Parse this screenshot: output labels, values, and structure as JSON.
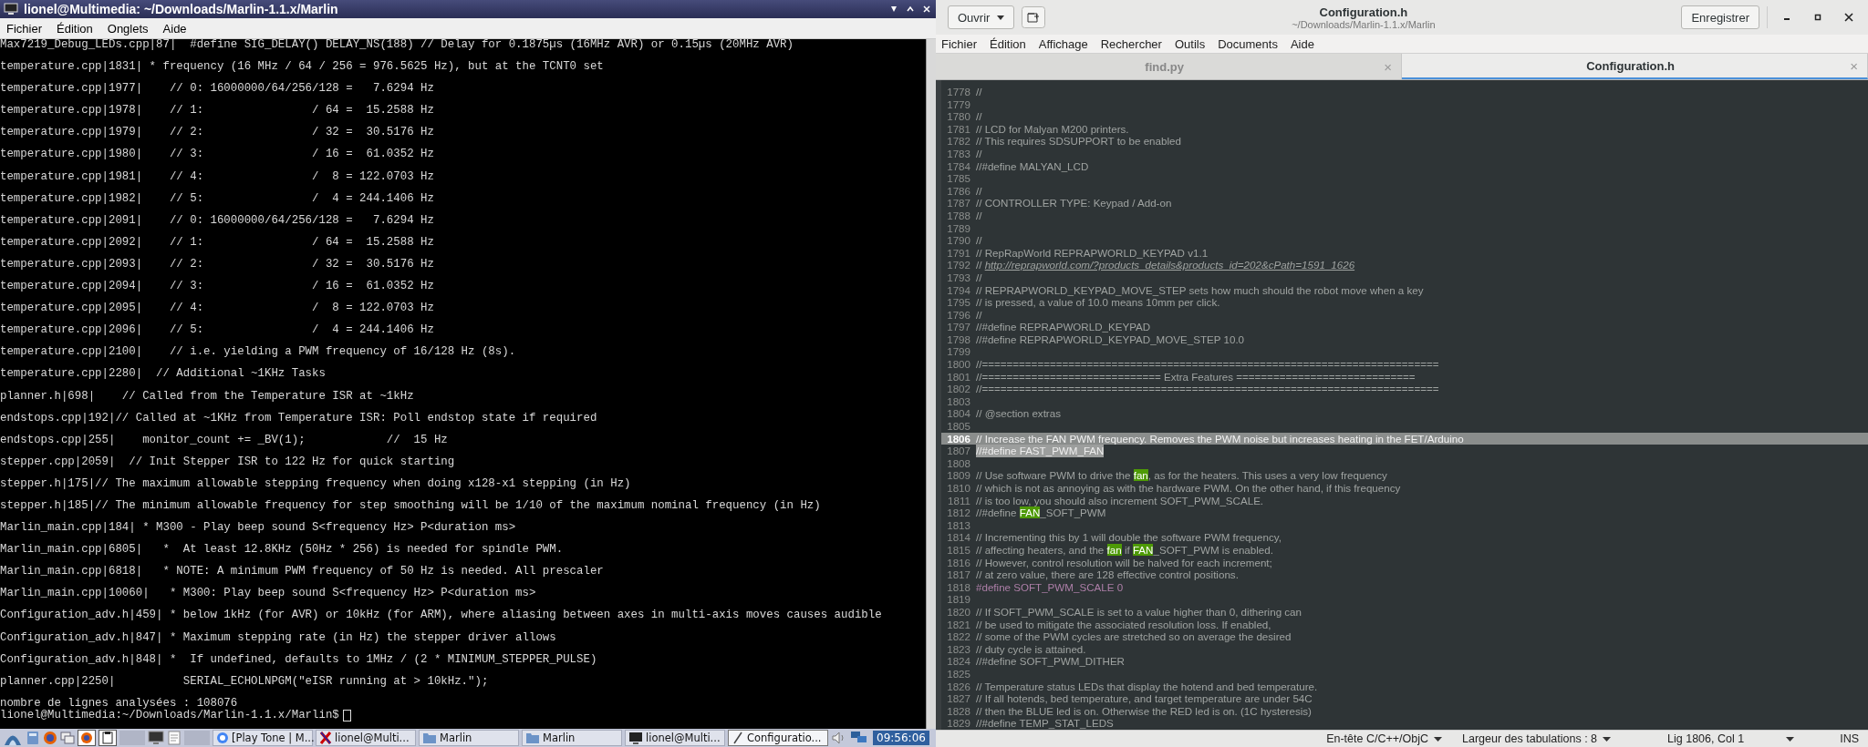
{
  "terminal": {
    "title": "lionel@Multimedia: ~/Downloads/Marlin-1.1.x/Marlin",
    "menu": [
      "Fichier",
      "Édition",
      "Onglets",
      "Aide"
    ],
    "lines": [
      "Max7219_Debug_LEDs.cpp|87|  #define SIG_DELAY() DELAY_NS(188) // Delay for 0.1875µs (16MHz AVR) or 0.15µs (20MHz AVR)",
      "temperature.cpp|1831| * frequency (16 MHz / 64 / 256 = 976.5625 Hz), but at the TCNT0 set",
      "temperature.cpp|1977|    // 0: 16000000/64/256/128 =   7.6294 Hz",
      "temperature.cpp|1978|    // 1:                / 64 =  15.2588 Hz",
      "temperature.cpp|1979|    // 2:                / 32 =  30.5176 Hz",
      "temperature.cpp|1980|    // 3:                / 16 =  61.0352 Hz",
      "temperature.cpp|1981|    // 4:                /  8 = 122.0703 Hz",
      "temperature.cpp|1982|    // 5:                /  4 = 244.1406 Hz",
      "temperature.cpp|2091|    // 0: 16000000/64/256/128 =   7.6294 Hz",
      "temperature.cpp|2092|    // 1:                / 64 =  15.2588 Hz",
      "temperature.cpp|2093|    // 2:                / 32 =  30.5176 Hz",
      "temperature.cpp|2094|    // 3:                / 16 =  61.0352 Hz",
      "temperature.cpp|2095|    // 4:                /  8 = 122.0703 Hz",
      "temperature.cpp|2096|    // 5:                /  4 = 244.1406 Hz",
      "temperature.cpp|2100|    // i.e. yielding a PWM frequency of 16/128 Hz (8s).",
      "temperature.cpp|2280|  // Additional ~1KHz Tasks",
      "planner.h|698|    // Called from the Temperature ISR at ~1kHz",
      "endstops.cpp|192|// Called at ~1KHz from Temperature ISR: Poll endstop state if required",
      "endstops.cpp|255|    monitor_count += _BV(1);            //  15 Hz",
      "stepper.cpp|2059|  // Init Stepper ISR to 122 Hz for quick starting",
      "stepper.h|175|// The maximum allowable stepping frequency when doing x128-x1 stepping (in Hz)",
      "stepper.h|185|// The minimum allowable frequency for step smoothing will be 1/10 of the maximum nominal frequency (in Hz)",
      "Marlin_main.cpp|184| * M300 - Play beep sound S<frequency Hz> P<duration ms>",
      "Marlin_main.cpp|6805|   *  At least 12.8KHz (50Hz * 256) is needed for spindle PWM.",
      "Marlin_main.cpp|6818|   * NOTE: A minimum PWM frequency of 50 Hz is needed. All prescaler",
      "Marlin_main.cpp|10060|   * M300: Play beep sound S<frequency Hz> P<duration ms>",
      "Configuration_adv.h|459| * below 1kHz (for AVR) or 10kHz (for ARM), where aliasing between axes in multi-axis moves causes audible",
      "Configuration_adv.h|847| * Maximum stepping rate (in Hz) the stepper driver allows",
      "Configuration_adv.h|848| *  If undefined, defaults to 1MHz / (2 * MINIMUM_STEPPER_PULSE)",
      "planner.cpp|2250|          SERIAL_ECHOLNPGM(\"eISR running at > 10kHz.\");"
    ],
    "summary": "nombre de lignes analysées : 108076",
    "prompt": "lionel@Multimedia:~/Downloads/Marlin-1.1.x/Marlin$"
  },
  "editor": {
    "open_button": "Ouvrir",
    "title": "Configuration.h",
    "path": "~/Downloads/Marlin-1.1.x/Marlin",
    "save_button": "Enregistrer",
    "menu": [
      "Fichier",
      "Édition",
      "Affichage",
      "Rechercher",
      "Outils",
      "Documents",
      "Aide"
    ],
    "tabs": [
      {
        "label": "find.py",
        "close": "×",
        "selected": false
      },
      {
        "label": "Configuration.h",
        "close": "×",
        "selected": true
      }
    ],
    "lines": [
      {
        "number": "1778",
        "current": false,
        "selected": false,
        "kind": "comment",
        "text": "//"
      },
      {
        "number": "1779",
        "current": false,
        "selected": false
      },
      {
        "number": "1780",
        "current": false,
        "selected": false,
        "kind": "comment",
        "text": "//"
      },
      {
        "number": "1781",
        "current": false,
        "selected": false,
        "kind": "comment",
        "text": "// LCD for Malyan M200 printers."
      },
      {
        "number": "1782",
        "current": false,
        "selected": false,
        "kind": "comment",
        "text": "// This requires SDSUPPORT to be enabled"
      },
      {
        "number": "1783",
        "current": false,
        "selected": false,
        "kind": "comment",
        "text": "//"
      },
      {
        "number": "1784",
        "current": false,
        "selected": false,
        "kind": "comment",
        "text": "//#define MALYAN_LCD"
      },
      {
        "number": "1785",
        "current": false,
        "selected": false
      },
      {
        "number": "1786",
        "current": false,
        "selected": false,
        "kind": "comment",
        "text": "//"
      },
      {
        "number": "1787",
        "current": false,
        "selected": false,
        "kind": "comment",
        "text": "// CONTROLLER TYPE: Keypad / Add-on"
      },
      {
        "number": "1788",
        "current": false,
        "selected": false,
        "kind": "comment",
        "text": "//"
      },
      {
        "number": "1789",
        "current": false,
        "selected": false
      },
      {
        "number": "1790",
        "current": false,
        "selected": false,
        "kind": "comment",
        "text": "//"
      },
      {
        "number": "1791",
        "current": false,
        "selected": false,
        "kind": "comment",
        "text": "// RepRapWorld REPRAPWORLD_KEYPAD v1.1"
      },
      {
        "number": "1792",
        "current": false,
        "selected": false,
        "parts": [
          {
            "kind": "comment",
            "text": "// "
          },
          {
            "kind": "link",
            "text": "http://reprapworld.com/?products_details&products_id=202&cPath=1591_1626"
          }
        ]
      },
      {
        "number": "1793",
        "current": false,
        "selected": false,
        "kind": "comment",
        "text": "//"
      },
      {
        "number": "1794",
        "current": false,
        "selected": false,
        "kind": "comment",
        "text": "// REPRAPWORLD_KEYPAD_MOVE_STEP sets how much should the robot move when a key"
      },
      {
        "number": "1795",
        "current": false,
        "selected": false,
        "kind": "comment",
        "text": "// is pressed, a value of 10.0 means 10mm per click."
      },
      {
        "number": "1796",
        "current": false,
        "selected": false,
        "kind": "comment",
        "text": "//"
      },
      {
        "number": "1797",
        "current": false,
        "selected": false,
        "kind": "comment",
        "text": "//#define REPRAPWORLD_KEYPAD"
      },
      {
        "number": "1798",
        "current": false,
        "selected": false,
        "kind": "comment",
        "text": "//#define REPRAPWORLD_KEYPAD_MOVE_STEP 10.0"
      },
      {
        "number": "1799",
        "current": false,
        "selected": false
      },
      {
        "number": "1800",
        "current": false,
        "selected": false,
        "kind": "comment",
        "text": "//=========================================================================="
      },
      {
        "number": "1801",
        "current": false,
        "selected": false,
        "kind": "comment",
        "text": "//============================= Extra Features ============================="
      },
      {
        "number": "1802",
        "current": false,
        "selected": false,
        "kind": "comment",
        "text": "//=========================================================================="
      },
      {
        "number": "1803",
        "current": false,
        "selected": false
      },
      {
        "number": "1804",
        "current": false,
        "selected": false,
        "kind": "comment",
        "text": "// @section extras"
      },
      {
        "number": "1805",
        "current": false,
        "selected": false
      },
      {
        "number": "1806",
        "current": true,
        "selected": false,
        "kind": "comment",
        "text": "// Increase the FAN PWM frequency. Removes the PWM noise but increases heating in the FET/Arduino"
      },
      {
        "number": "1807",
        "current": false,
        "selected": true,
        "kind": "comment",
        "text": "//#define FAST_PWM_FAN"
      },
      {
        "number": "1808",
        "current": false,
        "selected": false
      },
      {
        "number": "1809",
        "current": false,
        "selected": false,
        "parts": [
          {
            "kind": "comment",
            "text": "// Use software PWM to drive the "
          },
          {
            "kind": "match",
            "text": "fan"
          },
          {
            "kind": "comment",
            "text": ", as for the heaters. This uses a very low frequency"
          }
        ]
      },
      {
        "number": "1810",
        "current": false,
        "selected": false,
        "kind": "comment",
        "text": "// which is not as annoying as with the hardware PWM. On the other hand, if this frequency"
      },
      {
        "number": "1811",
        "current": false,
        "selected": false,
        "kind": "comment",
        "text": "// is too low, you should also increment SOFT_PWM_SCALE."
      },
      {
        "number": "1812",
        "current": false,
        "selected": false,
        "parts": [
          {
            "kind": "comment",
            "text": "//#define "
          },
          {
            "kind": "match",
            "text": "FAN"
          },
          {
            "kind": "comment",
            "text": "_SOFT_PWM"
          }
        ]
      },
      {
        "number": "1813",
        "current": false,
        "selected": false
      },
      {
        "number": "1814",
        "current": false,
        "selected": false,
        "kind": "comment",
        "text": "// Incrementing this by 1 will double the software PWM frequency,"
      },
      {
        "number": "1815",
        "current": false,
        "selected": false,
        "parts": [
          {
            "kind": "comment",
            "text": "// affecting heaters, and the "
          },
          {
            "kind": "match",
            "text": "fan"
          },
          {
            "kind": "comment",
            "text": " if "
          },
          {
            "kind": "match",
            "text": "FAN"
          },
          {
            "kind": "comment",
            "text": "_SOFT_PWM is enabled."
          }
        ]
      },
      {
        "number": "1816",
        "current": false,
        "selected": false,
        "kind": "comment",
        "text": "// However, control resolution will be halved for each increment;"
      },
      {
        "number": "1817",
        "current": false,
        "selected": false,
        "kind": "comment",
        "text": "// at zero value, there are 128 effective control positions."
      },
      {
        "number": "1818",
        "current": false,
        "selected": false,
        "kind": "directive",
        "text": "#define SOFT_PWM_SCALE 0"
      },
      {
        "number": "1819",
        "current": false,
        "selected": false
      },
      {
        "number": "1820",
        "current": false,
        "selected": false,
        "kind": "comment",
        "text": "// If SOFT_PWM_SCALE is set to a value higher than 0, dithering can"
      },
      {
        "number": "1821",
        "current": false,
        "selected": false,
        "kind": "comment",
        "text": "// be used to mitigate the associated resolution loss. If enabled,"
      },
      {
        "number": "1822",
        "current": false,
        "selected": false,
        "kind": "comment",
        "text": "// some of the PWM cycles are stretched so on average the desired"
      },
      {
        "number": "1823",
        "current": false,
        "selected": false,
        "kind": "comment",
        "text": "// duty cycle is attained."
      },
      {
        "number": "1824",
        "current": false,
        "selected": false,
        "kind": "comment",
        "text": "//#define SOFT_PWM_DITHER"
      },
      {
        "number": "1825",
        "current": false,
        "selected": false
      },
      {
        "number": "1826",
        "current": false,
        "selected": false,
        "kind": "comment",
        "text": "// Temperature status LEDs that display the hotend and bed temperature."
      },
      {
        "number": "1827",
        "current": false,
        "selected": false,
        "kind": "comment",
        "text": "// If all hotends, bed temperature, and target temperature are under 54C"
      },
      {
        "number": "1828",
        "current": false,
        "selected": false,
        "kind": "comment",
        "text": "// then the BLUE led is on. Otherwise the RED led is on. (1C hysteresis)"
      },
      {
        "number": "1829",
        "current": false,
        "selected": false,
        "kind": "comment",
        "text": "//#define TEMP_STAT_LEDS"
      }
    ],
    "status": {
      "language": "En-tête C/C++/ObjC",
      "tab_width": "Largeur des tabulations : 8",
      "position": "Lig 1806, Col 1",
      "mode": "INS"
    }
  },
  "taskbar": {
    "tasks": [
      {
        "kind": "browser",
        "label": "[Play Tone | M...",
        "selected": false
      },
      {
        "kind": "xterm",
        "label": "lionel@Multi...",
        "selected": false
      },
      {
        "kind": "folder",
        "label": "Marlin",
        "selected": false
      },
      {
        "kind": "folder",
        "label": "Marlin",
        "selected": false
      },
      {
        "kind": "terminal",
        "label": "lionel@Multi...",
        "selected": false
      },
      {
        "kind": "editor",
        "label": "Configuratio...",
        "selected": true
      }
    ],
    "clock": "09:56:06"
  }
}
